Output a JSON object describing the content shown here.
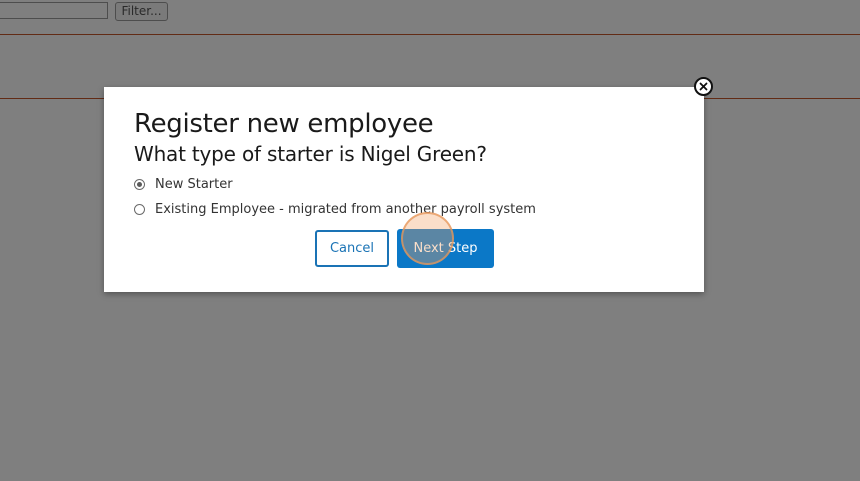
{
  "background": {
    "filter_button_label": "Filter..."
  },
  "dialog": {
    "title": "Register new employee",
    "subtitle": "What type of starter is Nigel Green?",
    "options": [
      {
        "label": "New Starter",
        "selected": true
      },
      {
        "label": "Existing Employee - migrated from another payroll system",
        "selected": false
      }
    ],
    "cancel_label": "Cancel",
    "next_label": "Next Step",
    "close_icon": "close-icon"
  },
  "colors": {
    "accent": "#0b78c7",
    "divider": "#c5562a"
  }
}
